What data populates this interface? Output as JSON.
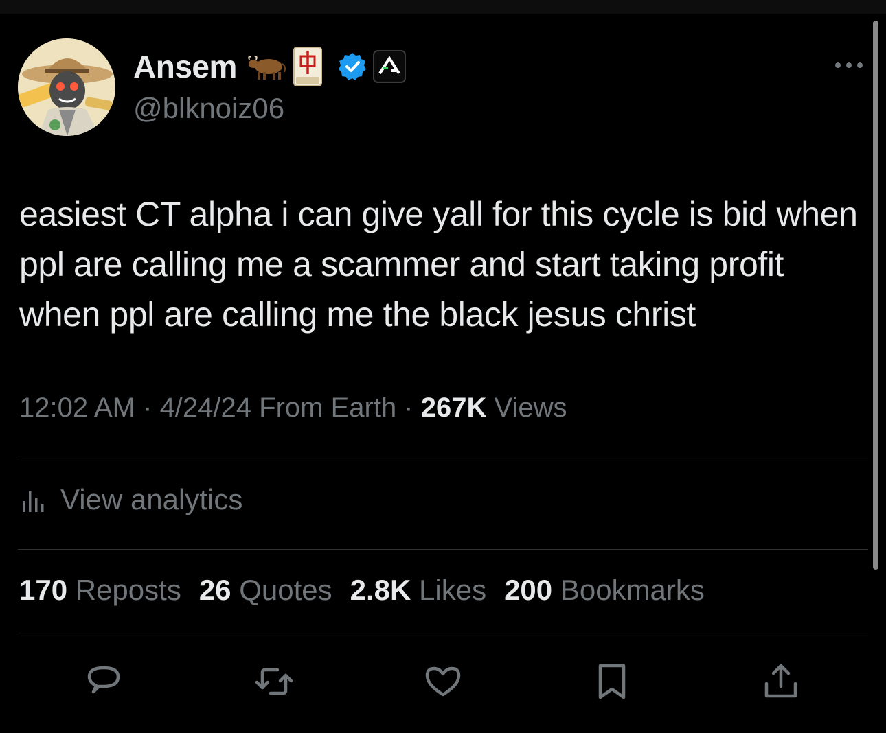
{
  "author": {
    "display_name": "Ansem",
    "handle": "@blknoiz06",
    "name_emoji": [
      "ox-icon",
      "red-dragon-mahjong-icon"
    ],
    "verified_color": "#1d9bf0"
  },
  "tweet": {
    "text": "easiest CT alpha i can give yall for this cycle is bid when ppl are calling me a scammer and start taking profit when ppl are calling me the black jesus christ"
  },
  "meta": {
    "time": "12:02 AM",
    "sep1": " · ",
    "date": "4/24/24",
    "location": " From Earth",
    "sep2": " · ",
    "views_count": "267K",
    "views_label": " Views"
  },
  "analytics": {
    "label": "View analytics"
  },
  "stats": [
    {
      "count": "170",
      "label": " Reposts"
    },
    {
      "count": "26",
      "label": " Quotes"
    },
    {
      "count": "2.8K",
      "label": " Likes"
    },
    {
      "count": "200",
      "label": " Bookmarks"
    }
  ],
  "actions": [
    "reply-icon",
    "repost-icon",
    "like-icon",
    "bookmark-icon",
    "share-icon"
  ],
  "colors": {
    "background": "#000000",
    "text_primary": "#e7e9ea",
    "text_secondary": "#71767b",
    "divider": "#2f3336",
    "accent": "#1d9bf0"
  }
}
